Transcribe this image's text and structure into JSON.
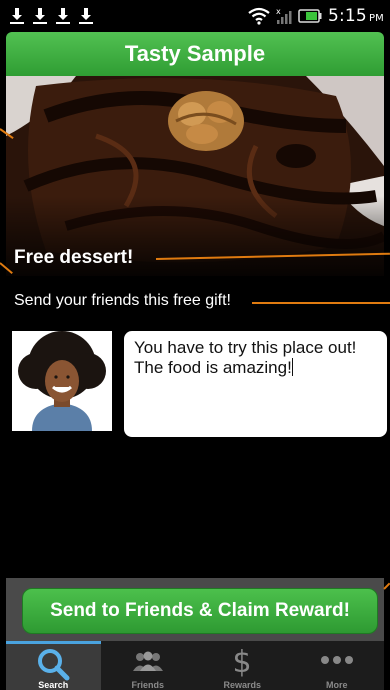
{
  "status_bar": {
    "time": "5:15",
    "ampm": "PM"
  },
  "header": {
    "title": "Tasty Sample"
  },
  "offer": {
    "headline": "Free dessert!",
    "subline": "Send your friends this free gift!"
  },
  "message": {
    "text": "You have to try this place out! The food is amazing!"
  },
  "cta": {
    "label": "Send to Friends & Claim Reward!"
  },
  "tabs": [
    {
      "label": "Search",
      "icon": "search-icon",
      "active": true
    },
    {
      "label": "Friends",
      "icon": "friends-icon",
      "active": false
    },
    {
      "label": "Rewards",
      "icon": "dollar-icon",
      "active": false
    },
    {
      "label": "More",
      "icon": "more-icon",
      "active": false
    }
  ],
  "colors": {
    "accent_green": "#3aaa3e",
    "callout_orange": "#e07b10",
    "tab_highlight": "#4aa3df"
  }
}
